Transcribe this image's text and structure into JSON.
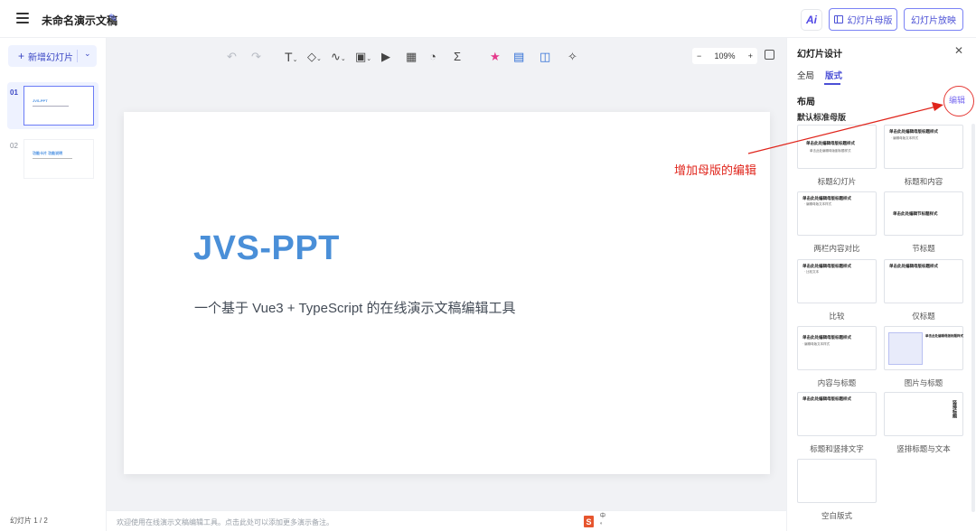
{
  "header": {
    "doc_title": "未命名演示文稿",
    "ai_label": "Ai",
    "master_button": "幻灯片母版",
    "play_button": "幻灯片放映"
  },
  "left_panel": {
    "new_slide_label": "新增幻灯片",
    "slides": [
      {
        "number": "01",
        "title": "JVS-PPT",
        "active": true
      },
      {
        "number": "02",
        "title": "功能卡片 功能说明",
        "active": false
      }
    ],
    "slide_count": "幻灯片 1 / 2"
  },
  "toolbar": {
    "zoom_level": "109%",
    "tools": [
      "undo-icon",
      "redo-icon",
      "text-icon",
      "shape-icon",
      "line-icon",
      "image-icon",
      "video-icon",
      "table-icon",
      "chart-icon",
      "formula-icon",
      "star-icon",
      "comment-icon",
      "panel-icon",
      "sparkle-icon"
    ]
  },
  "slide": {
    "title": "JVS-PPT",
    "subtitle": "一个基于 Vue3 + TypeScript 的在线演示文稿编辑工具"
  },
  "notes": {
    "text": "欢迎使用在线演示文稿编辑工具。点击此处可以添加更多演示备注。"
  },
  "ime": {
    "glyph": "S",
    "line1": "中",
    "line2": "。"
  },
  "right_panel": {
    "title": "幻灯片设计",
    "tabs": [
      {
        "label": "全局",
        "active": false
      },
      {
        "label": "版式",
        "active": true
      }
    ],
    "section_title": "布局",
    "edit_link": "编辑",
    "subsection_title": "默认标准母版",
    "layouts": [
      {
        "label": "标题幻灯片",
        "h": "单击此处编辑母版标题样式",
        "s": "单击此处编辑母版副标题样式"
      },
      {
        "label": "标题和内容",
        "h": "单击此处编辑母版标题样式",
        "s": "· 编辑母版文本样式"
      },
      {
        "label": "两栏内容对比",
        "h": "单击此处编辑母版标题样式",
        "s": "· 编辑母版文本样式"
      },
      {
        "label": "节标题",
        "h": "单击此处编辑节标题样式",
        "s": ""
      },
      {
        "label": "比较",
        "h": "单击此处编辑母版标题样式",
        "s": "· 比较文本"
      },
      {
        "label": "仅标题",
        "h": "单击此处编辑母版标题样式",
        "s": ""
      },
      {
        "label": "内容与标题",
        "h": "单击此处编辑母版标题样式",
        "s": "· 编辑母版文本样式"
      },
      {
        "label": "图片与标题",
        "h": "单击此处编辑母版标题样式",
        "s": ""
      },
      {
        "label": "标题和竖排文字",
        "h": "单击此处编辑母版标题样式",
        "s": ""
      },
      {
        "label": "竖排标题与文本",
        "h": "竖排标题",
        "s": ""
      },
      {
        "label": "空白版式",
        "h": "",
        "s": ""
      }
    ]
  },
  "annotation": {
    "text": "增加母版的编辑",
    "color": "#e0241b"
  },
  "colors": {
    "accent": "#4b50d6",
    "slide_title": "#4a8fd8"
  }
}
